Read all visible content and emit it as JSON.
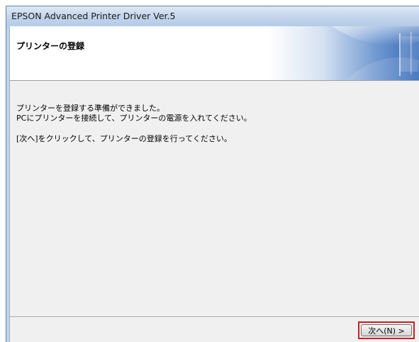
{
  "window": {
    "title": "EPSON Advanced Printer Driver Ver.5"
  },
  "header": {
    "title": "プリンターの登録"
  },
  "message": {
    "lines": [
      "プリンターを登録する準備ができました。",
      "PCにプリンターを接続して、プリンターの電源を入れてください。",
      "[次へ]をクリックして、プリンターの登録を行ってください。"
    ]
  },
  "buttons": {
    "next_label": "次へ(N) >"
  },
  "colors": {
    "highlight": "#cc1f1f",
    "banner_blue": "#2a62b4"
  }
}
